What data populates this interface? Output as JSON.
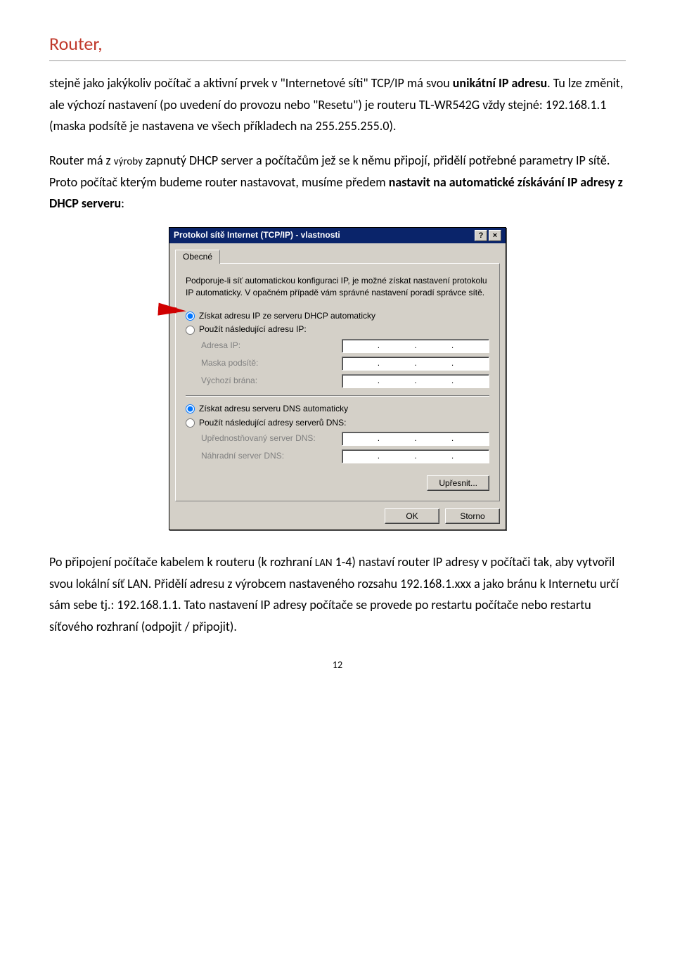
{
  "heading": "Router,",
  "para1_pre": "stejně jako jakýkoliv počítač a aktivní prvek v \"Internetové síti\" TCP/IP má svou ",
  "para1_bold": "unikátní IP adresu",
  "para1_post": ". Tu lze změnit, ale výchozí nastavení (po uvedení do provozu nebo \"Resetu\") je routeru TL-WR542G vždy stejné: 192.168.1.1 (maska podsítě je nastavena ve všech příkladech na 255.255.255.0).",
  "para2_pre": "Router má z ",
  "para2_small": "výroby",
  "para2_mid": " zapnutý DHCP server a počítačům jež se k němu připojí, přidělí potřebné parametry IP sítě. Proto počítač kterým budeme router nastavovat, musíme předem ",
  "para2_bold": "nastavit na automatické získávání IP adresy z DHCP serveru",
  "para2_post": ":",
  "dialog": {
    "title": "Protokol sítě Internet (TCP/IP) - vlastnosti",
    "help_btn": "?",
    "close_btn": "×",
    "tab": "Obecné",
    "desc": "Podporuje-li síť automatickou konfiguraci IP, je možné získat nastavení protokolu IP automaticky. V opačném případě vám správné nastavení poradí správce sítě.",
    "radio_ip_auto": "Získat adresu IP ze serveru DHCP automaticky",
    "radio_ip_manual": "Použít následující adresu IP:",
    "lbl_ip": "Adresa IP:",
    "lbl_mask": "Maska podsítě:",
    "lbl_gateway": "Výchozí brána:",
    "radio_dns_auto": "Získat adresu serveru DNS automaticky",
    "radio_dns_manual": "Použít následující adresy serverů DNS:",
    "lbl_dns1": "Upřednostňovaný server DNS:",
    "lbl_dns2": "Náhradní server DNS:",
    "btn_advanced": "Upřesnit...",
    "btn_ok": "OK",
    "btn_cancel": "Storno"
  },
  "para3_pre": "Po připojení počítače kabelem k routeru (k rozhraní ",
  "para3_small": "LAN",
  "para3_post": " 1-4) nastaví router IP adresy v počítači tak, aby vytvořil svou lokální síť LAN. Přidělí adresu z výrobcem nastaveného rozsahu 192.168.1.xxx a jako bránu k Internetu určí sám sebe tj.: 192.168.1.1. Tato nastavení IP adresy počítače se provede po restartu počítače nebo restartu síťového rozhraní (odpojit / připojit).",
  "page_number": "12"
}
